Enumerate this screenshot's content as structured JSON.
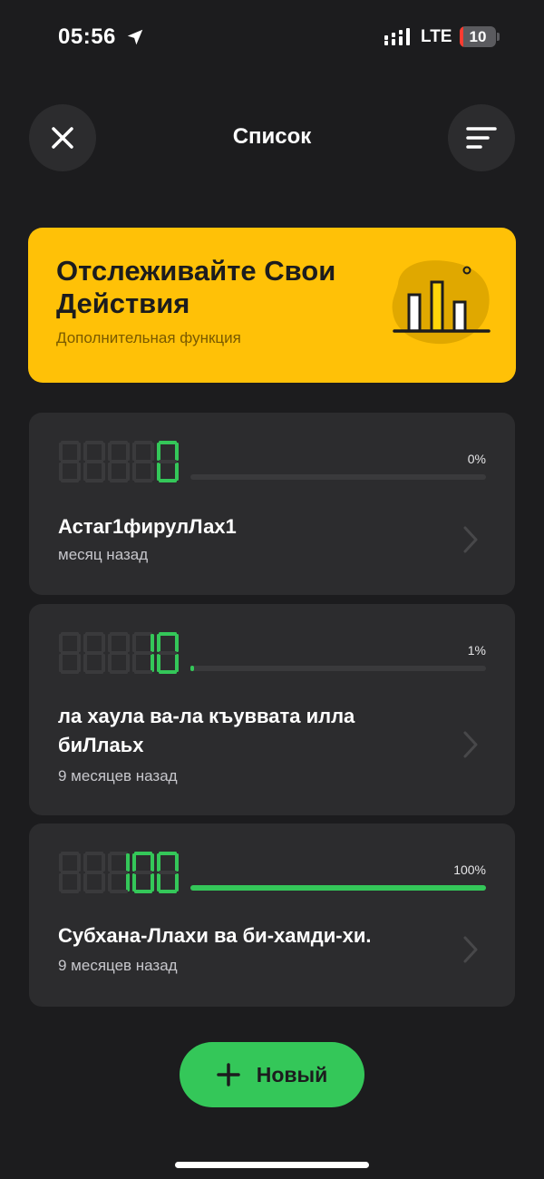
{
  "status_bar": {
    "time": "05:56",
    "network": "LTE",
    "battery_level": "10",
    "battery_fraction": 0.1,
    "battery_color": "#ff3b30"
  },
  "header": {
    "title": "Список",
    "close_icon": "close-icon",
    "filter_icon": "sort-lines-icon"
  },
  "promo": {
    "title": "Отслеживайте Свои Действия",
    "subtitle": "Дополнительная функция",
    "icon": "bar-chart-icon",
    "color": "#ffc107"
  },
  "counters": [
    {
      "title": "Астаг1фирулЛах1",
      "time": "месяц назад",
      "count": 0,
      "percent_label": "0%",
      "progress": 0.0
    },
    {
      "title": "ла хаула ва-ла къуввата илла биЛлаьх",
      "time": "9 месяцев назад",
      "count": 10,
      "percent_label": "1%",
      "progress": 0.01
    },
    {
      "title": "Субхана-Ллахи ва би-хамди-хи.",
      "time": "9 месяцев назад",
      "count": 100,
      "percent_label": "100%",
      "progress": 1.0
    }
  ],
  "new_button": {
    "label": "Новый",
    "icon": "plus-icon",
    "color": "#34c759"
  },
  "colors": {
    "background": "#1c1c1e",
    "card": "#2c2c2e",
    "accent_green": "#34c759",
    "accent_yellow": "#ffc107"
  }
}
